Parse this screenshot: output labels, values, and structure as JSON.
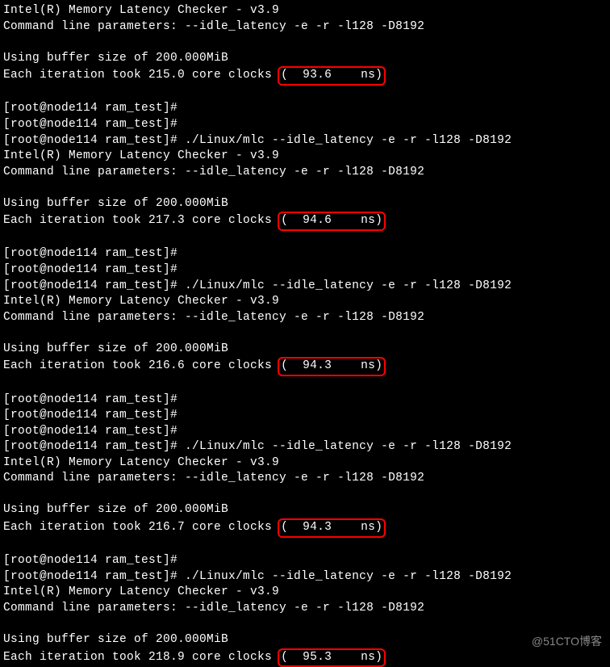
{
  "runs": [
    {
      "header1": "Intel(R) Memory Latency Checker - v3.9",
      "header2": "Command line parameters: --idle_latency -e -r -l128 -D8192",
      "buffer": "Using buffer size of 200.000MiB",
      "iter_prefix": "Each iteration took 215.0 core clocks ",
      "iter_box": "(  93.6    ns)",
      "prompts_before": 0,
      "show_cmd": false
    },
    {
      "prompt_empty": "[root@node114 ram_test]# ",
      "prompt_cmd": "[root@node114 ram_test]# ./Linux/mlc --idle_latency -e -r -l128 -D8192",
      "header1": "Intel(R) Memory Latency Checker - v3.9",
      "header2": "Command line parameters: --idle_latency -e -r -l128 -D8192",
      "buffer": "Using buffer size of 200.000MiB",
      "iter_prefix": "Each iteration took 217.3 core clocks ",
      "iter_box": "(  94.6    ns)",
      "prompts_before": 2,
      "show_cmd": true
    },
    {
      "prompt_empty": "[root@node114 ram_test]# ",
      "prompt_cmd": "[root@node114 ram_test]# ./Linux/mlc --idle_latency -e -r -l128 -D8192",
      "header1": "Intel(R) Memory Latency Checker - v3.9",
      "header2": "Command line parameters: --idle_latency -e -r -l128 -D8192",
      "buffer": "Using buffer size of 200.000MiB",
      "iter_prefix": "Each iteration took 216.6 core clocks ",
      "iter_box": "(  94.3    ns)",
      "prompts_before": 2,
      "show_cmd": true
    },
    {
      "prompt_empty": "[root@node114 ram_test]# ",
      "prompt_cmd": "[root@node114 ram_test]# ./Linux/mlc --idle_latency -e -r -l128 -D8192",
      "header1": "Intel(R) Memory Latency Checker - v3.9",
      "header2": "Command line parameters: --idle_latency -e -r -l128 -D8192",
      "buffer": "Using buffer size of 200.000MiB",
      "iter_prefix": "Each iteration took 216.7 core clocks ",
      "iter_box": "(  94.3    ns)",
      "prompts_before": 3,
      "show_cmd": true
    },
    {
      "prompt_empty": "[root@node114 ram_test]# ",
      "prompt_cmd": "[root@node114 ram_test]# ./Linux/mlc --idle_latency -e -r -l128 -D8192",
      "header1": "Intel(R) Memory Latency Checker - v3.9",
      "header2": "Command line parameters: --idle_latency -e -r -l128 -D8192",
      "buffer": "Using buffer size of 200.000MiB",
      "iter_prefix": "Each iteration took 218.9 core clocks ",
      "iter_box": "(  95.3    ns)",
      "prompts_before": 1,
      "show_cmd": true
    }
  ],
  "watermark": "@51CTO博客"
}
